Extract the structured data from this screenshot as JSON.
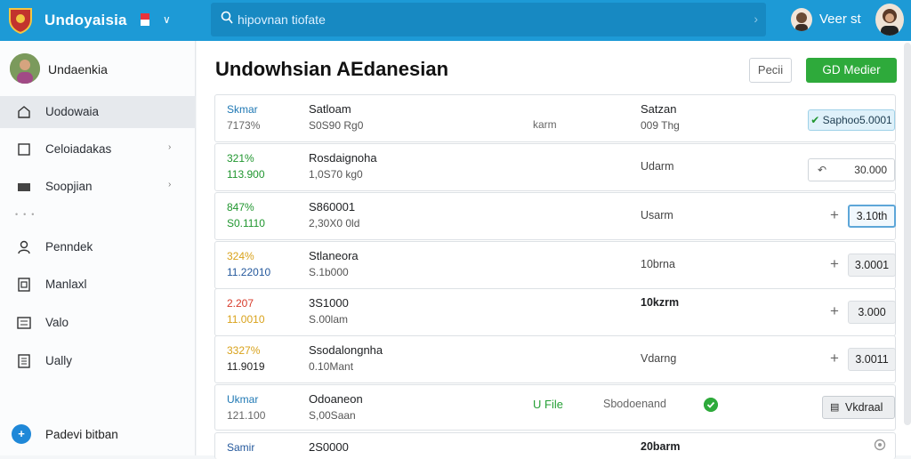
{
  "header": {
    "app_title": "Undoyaisia",
    "search_placeholder": "hipovnan tiofate",
    "user_name": "Veer st"
  },
  "sidebar": {
    "profile_name": "Undaenkia",
    "items": [
      {
        "label": "Uodowaia",
        "icon": "home-icon",
        "active": true,
        "chevron": false
      },
      {
        "label": "Celoiadakas",
        "icon": "bookmark-icon",
        "active": false,
        "chevron": true
      },
      {
        "label": "Soopjian",
        "icon": "folder-icon",
        "active": false,
        "chevron": true
      },
      {
        "label": "Penndek",
        "icon": "user-icon",
        "active": false,
        "chevron": false
      },
      {
        "label": "Manlaxl",
        "icon": "document-icon",
        "active": false,
        "chevron": false
      },
      {
        "label": "Valo",
        "icon": "list-icon",
        "active": false,
        "chevron": false
      },
      {
        "label": "Ually",
        "icon": "notes-icon",
        "active": false,
        "chevron": false
      }
    ],
    "footer_label": "Padevi bitban",
    "footer_icon": "plus-circle-icon"
  },
  "main": {
    "title": "Undowhsian AEdanesian",
    "button_secondary": "Pecii",
    "button_primary": "GD Medier",
    "rows": [
      {
        "c1a": "Skmar",
        "c1b": "7173%",
        "c1a_color": "blue",
        "c1b_color": "gray",
        "c2a": "Satloam",
        "c2b": "S0S90 Rg0",
        "c3": "karm",
        "c4a": "Satzan",
        "c4b": "009 Thg",
        "action_type": "pill-green",
        "action": "Saphoo5.0001"
      },
      {
        "c1a": "321%",
        "c1b": "113.900",
        "c1a_color": "green",
        "c1b_color": "green",
        "c2a": "Rosdaignoha",
        "c2b": "1,0S70 kg0",
        "c4_mid": "Udarm",
        "action_type": "pill-share",
        "action": "30.000"
      },
      {
        "c1a": "847%",
        "c1b": "S0.1110",
        "c1a_color": "green",
        "c1b_color": "green",
        "c2a": "S860001",
        "c2b": "2,30X0 0ld",
        "c4_mid": "Usarm",
        "action_type": "chip-blue",
        "action": "3.10th"
      },
      {
        "c1a": "324%",
        "c1b": "11.22010",
        "c1a_color": "orange",
        "c1b_color": "navy",
        "c2a": "Stlaneora",
        "c2b": "S.1b000",
        "c4_mid": "10brna",
        "action_type": "chip",
        "action": "3.0001"
      },
      {
        "c1a": "2.207",
        "c1b": "11.0010",
        "c1a_color": "red",
        "c1b_color": "orange",
        "c2a": "3S1000",
        "c2b": "S.00lam",
        "c4_top": "10kzrm",
        "action_type": "chip",
        "action": "3.000"
      },
      {
        "c1a": "3327%",
        "c1b": "11.9019",
        "c1a_color": "orange",
        "c1b_color": "dark",
        "c2a": "Ssodalongnha",
        "c2b": "0.10Mant",
        "c4_mid": "Vdarng",
        "action_type": "chip",
        "action": "3.0011"
      },
      {
        "c1a": "Ukmar",
        "c1b": "121.100",
        "c1a_color": "blue",
        "c1b_color": "gray",
        "c2a": "Odoaneon",
        "c2b": "S,00Saan",
        "ufile": "U File",
        "c3b": "Sbodoenand",
        "status_icon": "check-circle-icon",
        "action_type": "pill-gray",
        "action": "Vkdraal"
      },
      {
        "c1a": "Samir",
        "c1b": "",
        "c1a_color": "navy",
        "c1b_color": "gray",
        "c2a": "2S0000",
        "c2b": "",
        "c4_top": "20barm",
        "action_type": "gear",
        "action": ""
      }
    ]
  },
  "colors": {
    "topbar": "#1d9ad6",
    "primary_button": "#2eaa3b",
    "accent_blue": "#1f78b4"
  }
}
